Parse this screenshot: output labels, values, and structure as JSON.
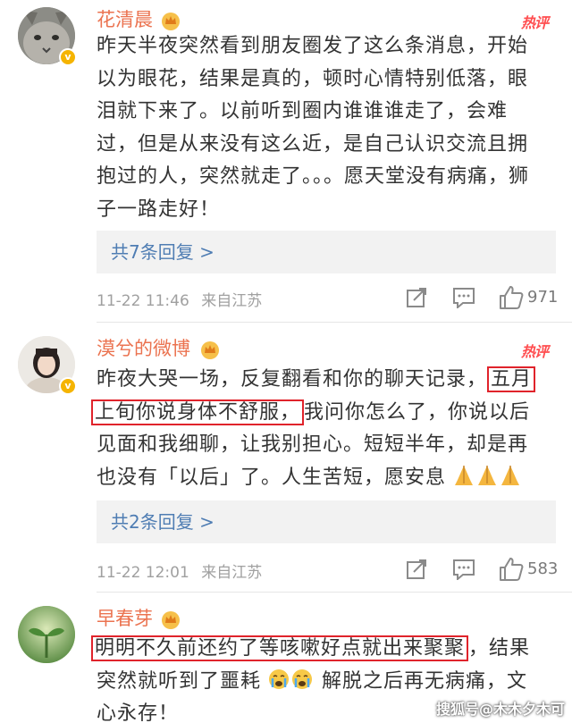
{
  "colors": {
    "username": "#eb7350",
    "link": "#4f7db3",
    "highlight_box": "#e0232b",
    "hot": "#ff4d4f",
    "meta": "#a0a0a0"
  },
  "comments": [
    {
      "username": "花清晨",
      "hot_label": "热评",
      "lines": [
        "昨天半夜突然看到朋友圈发了这么条消息，开始",
        "以为眼花，结果是真的，顿时心情特别低落，眼",
        "泪就下来了。以前听到圈内谁谁谁走了，会难",
        "过，但是从来没有这么近，是自己认识交流且拥",
        "抱过的人，突然就走了。。。愿天堂没有病痛，狮",
        "子一路走好！"
      ],
      "replies": "共7条回复 >",
      "time": "11-22 11:46",
      "location": "来自江苏",
      "likes": "971"
    },
    {
      "username": "漠兮的微博",
      "hot_label": "热评",
      "line1_a": "昨夜大哭一场，反复翻看和你的聊天记录，",
      "line1_hl": "五月",
      "line2_hl": "上旬你说身体不舒服，",
      "line2_b": "我问你怎么了，你说以后",
      "line3": "见面和我细聊，让我别担心。短短半年，却是再",
      "line4": "也没有「以后」了。人生苦短，愿安息",
      "replies": "共2条回复 >",
      "time": "11-22 12:01",
      "location": "来自江苏",
      "likes": "583"
    },
    {
      "username": "早春芽",
      "line1_hl": "明明不久前还约了等咳嗽好点就出来聚聚",
      "line1_b": "，结果",
      "line2_a": "突然就听到了噩耗",
      "line2_b": "解脱之后再无病痛，文",
      "line3": "心永存！"
    }
  ],
  "icons": [
    "crown-icon",
    "verified-badge-icon",
    "share-icon",
    "comment-icon",
    "like-icon",
    "pray-emoji",
    "crying-emoji"
  ],
  "watermark": "搜狐号@木木夕木可"
}
